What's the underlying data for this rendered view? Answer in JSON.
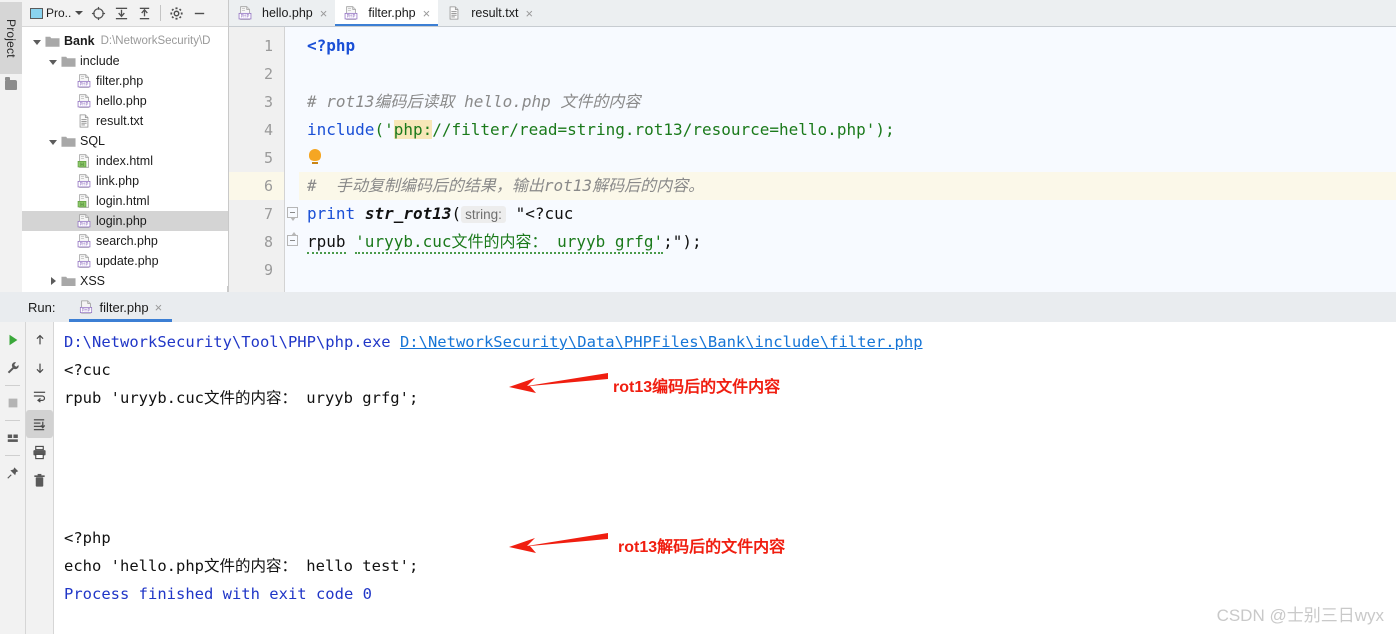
{
  "left_strip": {
    "tab_label": "Project",
    "folder_icon": "folder-icon"
  },
  "project_panel": {
    "toolbar": {
      "combo_label": "Pro..",
      "icons": [
        {
          "name": "select-opened-file-icon",
          "glyph": "locate"
        },
        {
          "name": "expand-all-icon",
          "glyph": "expand"
        },
        {
          "name": "collapse-all-icon",
          "glyph": "collapse"
        },
        {
          "name": "settings-gear-icon",
          "glyph": "gear"
        },
        {
          "name": "hide-panel-icon",
          "glyph": "minus"
        }
      ]
    },
    "tree": [
      {
        "indent": 0,
        "twisty": "down",
        "icon": "folder-icon",
        "label": "Bank",
        "bold": true,
        "path": "D:\\NetworkSecurity\\D",
        "selected": false
      },
      {
        "indent": 1,
        "twisty": "down",
        "icon": "folder-icon",
        "label": "include",
        "bold": false,
        "path": "",
        "selected": false
      },
      {
        "indent": 2,
        "twisty": "none",
        "icon": "php-file-icon",
        "label": "filter.php",
        "bold": false,
        "path": "",
        "selected": false
      },
      {
        "indent": 2,
        "twisty": "none",
        "icon": "php-file-icon",
        "label": "hello.php",
        "bold": false,
        "path": "",
        "selected": false
      },
      {
        "indent": 2,
        "twisty": "none",
        "icon": "text-file-icon",
        "label": "result.txt",
        "bold": false,
        "path": "",
        "selected": false
      },
      {
        "indent": 1,
        "twisty": "down",
        "icon": "folder-icon",
        "label": "SQL",
        "bold": false,
        "path": "",
        "selected": false
      },
      {
        "indent": 2,
        "twisty": "none",
        "icon": "html-file-icon",
        "label": "index.html",
        "bold": false,
        "path": "",
        "selected": false
      },
      {
        "indent": 2,
        "twisty": "none",
        "icon": "php-file-icon",
        "label": "link.php",
        "bold": false,
        "path": "",
        "selected": false
      },
      {
        "indent": 2,
        "twisty": "none",
        "icon": "html-file-icon",
        "label": "login.html",
        "bold": false,
        "path": "",
        "selected": false
      },
      {
        "indent": 2,
        "twisty": "none",
        "icon": "php-file-icon",
        "label": "login.php",
        "bold": false,
        "path": "",
        "selected": true
      },
      {
        "indent": 2,
        "twisty": "none",
        "icon": "php-file-icon",
        "label": "search.php",
        "bold": false,
        "path": "",
        "selected": false
      },
      {
        "indent": 2,
        "twisty": "none",
        "icon": "php-file-icon",
        "label": "update.php",
        "bold": false,
        "path": "",
        "selected": false
      },
      {
        "indent": 1,
        "twisty": "right",
        "icon": "folder-icon",
        "label": "XSS",
        "bold": false,
        "path": "",
        "selected": false
      }
    ]
  },
  "editor": {
    "tabs": [
      {
        "label": "hello.php",
        "icon": "php-file-icon",
        "active": false,
        "close": "×"
      },
      {
        "label": "filter.php",
        "icon": "php-file-icon",
        "active": true,
        "close": "×"
      },
      {
        "label": "result.txt",
        "icon": "text-file-icon",
        "active": false,
        "close": "×"
      }
    ],
    "line_numbers": [
      "1",
      "2",
      "3",
      "4",
      "5",
      "6",
      "7",
      "8",
      "9"
    ],
    "lines": {
      "l1_php_open": "<?php",
      "l3_comment": "# rot13编码后读取 hello.php 文件的内容",
      "l4_include_kw": "include",
      "l4_paren_open": "('",
      "l4_scheme": "php:",
      "l4_rest": "//filter/read=string.rot13/resource=hello.php'",
      "l4_paren_close": ");",
      "l6_comment": "#  手动复制编码后的结果，输出rot13解码后的内容。",
      "l7_print": "print",
      "l7_fn": "str_rot13",
      "l7_paren": "(",
      "l7_hint": "string:",
      "l7_str": "\"<?cuc",
      "l8_str_a": "rpub",
      "l8_str_b": "'uryyb.cuc文件的内容： uryyb grfg'",
      "l8_tail": ";\");"
    },
    "hint_bulb": "lightbulb-icon",
    "highlighted_line": "6"
  },
  "run_panel": {
    "label": "Run:",
    "tab": {
      "label": "filter.php",
      "icon": "php-file-icon",
      "close": "×"
    },
    "left_toolbar": [
      {
        "name": "rerun-button",
        "glyph": "play"
      },
      {
        "name": "edit-configurations-button",
        "glyph": "wrench"
      },
      {
        "name": "stop-button",
        "glyph": "stop"
      },
      {
        "name": "layout-settings-button",
        "glyph": "layout"
      },
      {
        "name": "pin-tab-button",
        "glyph": "pin"
      }
    ],
    "second_toolbar": [
      {
        "name": "previous-occurrence-button",
        "glyph": "up"
      },
      {
        "name": "next-occurrence-button",
        "glyph": "down"
      },
      {
        "name": "soft-wrap-button",
        "glyph": "wrap"
      },
      {
        "name": "scroll-to-end-button",
        "glyph": "scroll-end",
        "selected": true
      },
      {
        "name": "print-button",
        "glyph": "print"
      },
      {
        "name": "clear-all-button",
        "glyph": "trash"
      }
    ],
    "console": {
      "line1_cmd": "D:\\NetworkSecurity\\Tool\\PHP\\php.exe ",
      "line1_link": "D:\\NetworkSecurity\\Data\\PHPFiles\\Bank\\include\\filter.php",
      "line2": "<?cuc",
      "line3": "rpub 'uryyb.cuc文件的内容： uryyb grfg';",
      "line4": "<?php",
      "line5": "echo 'hello.php文件的内容： hello test';",
      "line6": "Process finished with exit code 0"
    },
    "annotations": [
      {
        "name": "annotation-encoded",
        "text": "rot13编码后的文件内容",
        "color": "#f01e10"
      },
      {
        "name": "annotation-decoded",
        "text": "rot13解码后的文件内容",
        "color": "#f01e10"
      }
    ]
  },
  "watermark": {
    "text": "CSDN @士别三日wyx"
  }
}
